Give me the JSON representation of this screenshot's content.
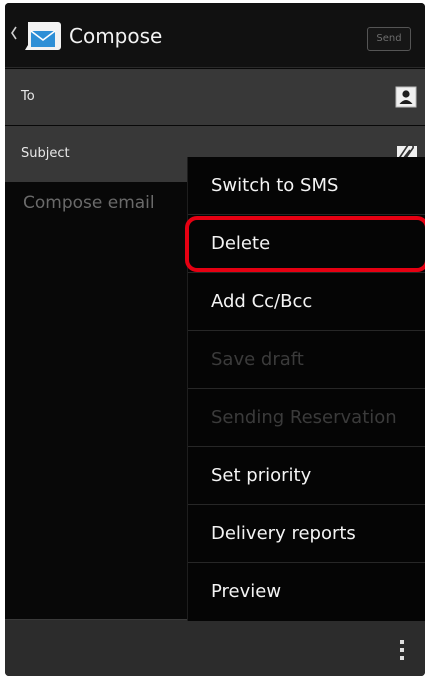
{
  "action_bar": {
    "title": "Compose",
    "send_label": "Send",
    "back_icon": "chevron-left-icon",
    "app_icon": "email-app-icon"
  },
  "fields": {
    "to_label": "To",
    "to_icon": "contact-picker-icon",
    "subject_label": "Subject",
    "subject_icon": "paperclip-icon"
  },
  "body": {
    "placeholder": "Compose email"
  },
  "menu": {
    "items": [
      {
        "label": "Switch to SMS",
        "enabled": true
      },
      {
        "label": "Delete",
        "enabled": true,
        "highlighted": true
      },
      {
        "label": "Add Cc/Bcc",
        "enabled": true
      },
      {
        "label": "Save draft",
        "enabled": false
      },
      {
        "label": "Sending Reservation",
        "enabled": false
      },
      {
        "label": "Set priority",
        "enabled": true
      },
      {
        "label": "Delivery reports",
        "enabled": true
      },
      {
        "label": "Preview",
        "enabled": true
      }
    ]
  },
  "bottom_bar": {
    "overflow_icon": "overflow-menu-icon"
  },
  "colors": {
    "highlight": "#e60012",
    "field_background": "#383838",
    "menu_background": "#050505"
  }
}
